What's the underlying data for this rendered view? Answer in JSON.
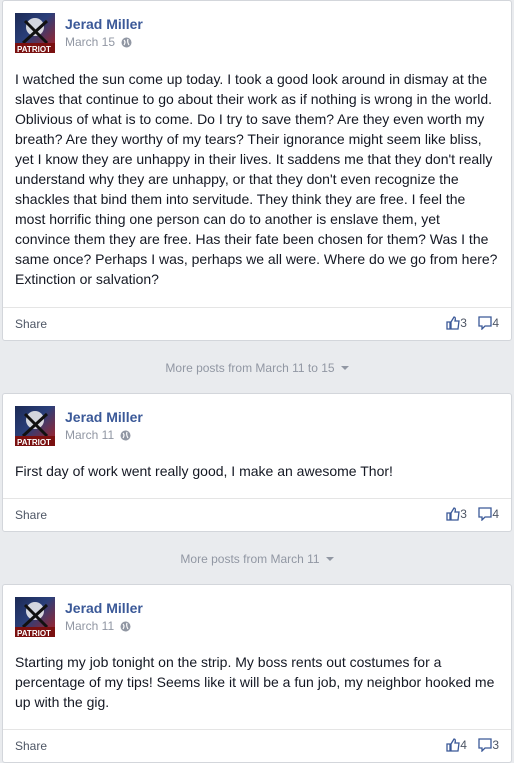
{
  "posts": [
    {
      "author": "Jerad Miller",
      "date": "March 15",
      "text": "I watched the sun come up today. I took a good look around in dismay at the slaves that continue to go about their work as if nothing is wrong in the world. Oblivious of what is to come. Do I try to save them? Are they even worth my breath? Are they worthy of my tears? Their ignorance might seem like bliss, yet I know they are unhappy in their lives. It saddens me that they don't really understand why they are unhappy, or that they don't even recognize the shackles that bind them into servitude. They think they are free. I feel the most horrific thing one person can do to another is enslave them, yet convince them they are free. Has their fate been chosen for them? Was I the same once? Perhaps I was, perhaps we all were. Where do we go from here? Extinction or salvation?",
      "share_label": "Share",
      "likes": "3",
      "comments": "4"
    },
    {
      "author": "Jerad Miller",
      "date": "March 11",
      "text": "First day of work went really good, I make an awesome Thor!",
      "share_label": "Share",
      "likes": "3",
      "comments": "4"
    },
    {
      "author": "Jerad Miller",
      "date": "March 11",
      "text": "Starting my job tonight on the strip. My boss rents out costumes for a percentage of my tips! Seems like it will be a fun job, my neighbor hooked me up with the gig.",
      "share_label": "Share",
      "likes": "4",
      "comments": "3"
    }
  ],
  "more_posts": [
    "More posts from March 11 to 15",
    "More posts from March 11"
  ],
  "avatar_text": "PATRIOT",
  "colors": {
    "author": "#3b5998",
    "meta": "#9197a3",
    "page_bg": "#e9ebee"
  }
}
